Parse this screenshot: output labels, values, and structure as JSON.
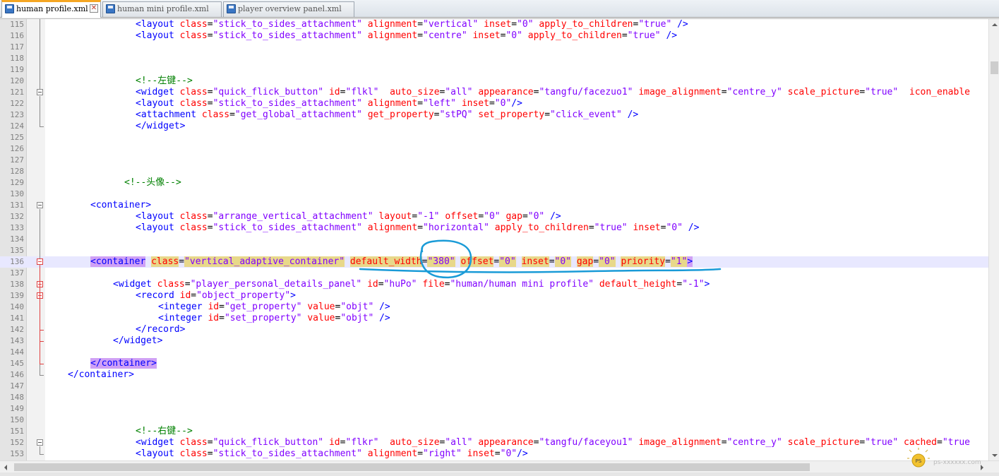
{
  "tabs": [
    {
      "label": "human profile.xml",
      "active": true
    },
    {
      "label": "human mini profile.xml",
      "active": false
    },
    {
      "label": "player overview panel.xml",
      "active": false
    }
  ],
  "tab_close_glyph": "✕",
  "highlight_color": "#e8e8ff",
  "annotation_color": "#1a9bd7",
  "watermark": {
    "badge": "PS",
    "text": "ps-xxxxxx.com"
  },
  "lines": [
    {
      "n": "115",
      "indent": 16,
      "tokens": [
        [
          "tag",
          "<layout "
        ],
        [
          "attr",
          "class"
        ],
        [
          "txt",
          "="
        ],
        [
          "val",
          "\"stick_to_sides_attachment\""
        ],
        [
          "txt",
          " "
        ],
        [
          "attr",
          "alignment"
        ],
        [
          "txt",
          "="
        ],
        [
          "val",
          "\"vertical\""
        ],
        [
          "txt",
          " "
        ],
        [
          "attr",
          "inset"
        ],
        [
          "txt",
          "="
        ],
        [
          "val",
          "\"0\""
        ],
        [
          "txt",
          " "
        ],
        [
          "attr",
          "apply_to_children"
        ],
        [
          "txt",
          "="
        ],
        [
          "val",
          "\"true\""
        ],
        [
          "txt",
          " "
        ],
        [
          "tag",
          "/>"
        ]
      ]
    },
    {
      "n": "116",
      "indent": 16,
      "tokens": [
        [
          "tag",
          "<layout "
        ],
        [
          "attr",
          "class"
        ],
        [
          "txt",
          "="
        ],
        [
          "val",
          "\"stick_to_sides_attachment\""
        ],
        [
          "txt",
          " "
        ],
        [
          "attr",
          "alignment"
        ],
        [
          "txt",
          "="
        ],
        [
          "val",
          "\"centre\""
        ],
        [
          "txt",
          " "
        ],
        [
          "attr",
          "inset"
        ],
        [
          "txt",
          "="
        ],
        [
          "val",
          "\"0\""
        ],
        [
          "txt",
          " "
        ],
        [
          "attr",
          "apply_to_children"
        ],
        [
          "txt",
          "="
        ],
        [
          "val",
          "\"true\""
        ],
        [
          "txt",
          " "
        ],
        [
          "tag",
          "/>"
        ]
      ]
    },
    {
      "n": "117",
      "indent": 0,
      "tokens": []
    },
    {
      "n": "118",
      "indent": 0,
      "tokens": []
    },
    {
      "n": "119",
      "indent": 0,
      "tokens": []
    },
    {
      "n": "120",
      "indent": 16,
      "tokens": [
        [
          "com",
          "<!--左键-->"
        ]
      ]
    },
    {
      "n": "121",
      "indent": 16,
      "tokens": [
        [
          "tag",
          "<widget "
        ],
        [
          "attr",
          "class"
        ],
        [
          "txt",
          "="
        ],
        [
          "val",
          "\"quick_flick_button\""
        ],
        [
          "txt",
          " "
        ],
        [
          "attr",
          "id"
        ],
        [
          "txt",
          "="
        ],
        [
          "val",
          "\"flkl\""
        ],
        [
          "txt",
          "  "
        ],
        [
          "attr",
          "auto_size"
        ],
        [
          "txt",
          "="
        ],
        [
          "val",
          "\"all\""
        ],
        [
          "txt",
          " "
        ],
        [
          "attr",
          "appearance"
        ],
        [
          "txt",
          "="
        ],
        [
          "val",
          "\"tangfu/facezuo1\""
        ],
        [
          "txt",
          " "
        ],
        [
          "attr",
          "image_alignment"
        ],
        [
          "txt",
          "="
        ],
        [
          "val",
          "\"centre_y\""
        ],
        [
          "txt",
          " "
        ],
        [
          "attr",
          "scale_picture"
        ],
        [
          "txt",
          "="
        ],
        [
          "val",
          "\"true\""
        ],
        [
          "txt",
          "  "
        ],
        [
          "attr",
          "icon_enable"
        ]
      ]
    },
    {
      "n": "122",
      "indent": 16,
      "tokens": [
        [
          "tag",
          "<layout "
        ],
        [
          "attr",
          "class"
        ],
        [
          "txt",
          "="
        ],
        [
          "val",
          "\"stick_to_sides_attachment\""
        ],
        [
          "txt",
          " "
        ],
        [
          "attr",
          "alignment"
        ],
        [
          "txt",
          "="
        ],
        [
          "val",
          "\"left\""
        ],
        [
          "txt",
          " "
        ],
        [
          "attr",
          "inset"
        ],
        [
          "txt",
          "="
        ],
        [
          "val",
          "\"0\""
        ],
        [
          "tag",
          "/>"
        ]
      ]
    },
    {
      "n": "123",
      "indent": 16,
      "tokens": [
        [
          "tag",
          "<attachment "
        ],
        [
          "attr",
          "class"
        ],
        [
          "txt",
          "="
        ],
        [
          "val",
          "\"get_global_attachment\""
        ],
        [
          "txt",
          " "
        ],
        [
          "attr",
          "get_property"
        ],
        [
          "txt",
          "="
        ],
        [
          "val",
          "\"stPQ\""
        ],
        [
          "txt",
          " "
        ],
        [
          "attr",
          "set_property"
        ],
        [
          "txt",
          "="
        ],
        [
          "val",
          "\"click_event\""
        ],
        [
          "txt",
          " "
        ],
        [
          "tag",
          "/>"
        ]
      ]
    },
    {
      "n": "124",
      "indent": 16,
      "tokens": [
        [
          "tag",
          "</widget>"
        ]
      ]
    },
    {
      "n": "125",
      "indent": 0,
      "tokens": []
    },
    {
      "n": "126",
      "indent": 0,
      "tokens": []
    },
    {
      "n": "127",
      "indent": 0,
      "tokens": []
    },
    {
      "n": "128",
      "indent": 0,
      "tokens": []
    },
    {
      "n": "129",
      "indent": 14,
      "tokens": [
        [
          "com",
          "<!--头像-->"
        ]
      ]
    },
    {
      "n": "130",
      "indent": 0,
      "tokens": []
    },
    {
      "n": "131",
      "indent": 8,
      "tokens": [
        [
          "tag",
          "<container>"
        ]
      ]
    },
    {
      "n": "132",
      "indent": 16,
      "tokens": [
        [
          "tag",
          "<layout "
        ],
        [
          "attr",
          "class"
        ],
        [
          "txt",
          "="
        ],
        [
          "val",
          "\"arrange_vertical_attachment\""
        ],
        [
          "txt",
          " "
        ],
        [
          "attr",
          "layout"
        ],
        [
          "txt",
          "="
        ],
        [
          "val",
          "\"-1\""
        ],
        [
          "txt",
          " "
        ],
        [
          "attr",
          "offset"
        ],
        [
          "txt",
          "="
        ],
        [
          "val",
          "\"0\""
        ],
        [
          "txt",
          " "
        ],
        [
          "attr",
          "gap"
        ],
        [
          "txt",
          "="
        ],
        [
          "val",
          "\"0\""
        ],
        [
          "txt",
          " "
        ],
        [
          "tag",
          "/>"
        ]
      ]
    },
    {
      "n": "133",
      "indent": 16,
      "tokens": [
        [
          "tag",
          "<layout "
        ],
        [
          "attr",
          "class"
        ],
        [
          "txt",
          "="
        ],
        [
          "val",
          "\"stick_to_sides_attachment\""
        ],
        [
          "txt",
          " "
        ],
        [
          "attr",
          "alignment"
        ],
        [
          "txt",
          "="
        ],
        [
          "val",
          "\"horizontal\""
        ],
        [
          "txt",
          " "
        ],
        [
          "attr",
          "apply_to_children"
        ],
        [
          "txt",
          "="
        ],
        [
          "val",
          "\"true\""
        ],
        [
          "txt",
          " "
        ],
        [
          "attr",
          "inset"
        ],
        [
          "txt",
          "="
        ],
        [
          "val",
          "\"0\""
        ],
        [
          "txt",
          " "
        ],
        [
          "tag",
          "/>"
        ]
      ]
    },
    {
      "n": "134",
      "indent": 0,
      "tokens": []
    },
    {
      "n": "135",
      "indent": 0,
      "tokens": []
    },
    {
      "n": "136",
      "indent": 8,
      "tokens": [
        [
          "tag",
          "<container"
        ],
        [
          "txt",
          " "
        ],
        [
          "attr",
          "class"
        ],
        [
          "txt",
          "="
        ],
        [
          "val",
          "\"vertical_adaptive_container\""
        ],
        [
          "txt",
          " "
        ],
        [
          "attr",
          "default_width"
        ],
        [
          "txt",
          "="
        ],
        [
          "val",
          "\"380\""
        ],
        [
          "txt",
          " "
        ],
        [
          "attr",
          "offset"
        ],
        [
          "txt",
          "="
        ],
        [
          "val",
          "\"0\""
        ],
        [
          "txt",
          " "
        ],
        [
          "attr",
          "inset"
        ],
        [
          "txt",
          "="
        ],
        [
          "val",
          "\"0\""
        ],
        [
          "txt",
          " "
        ],
        [
          "attr",
          "gap"
        ],
        [
          "txt",
          "="
        ],
        [
          "val",
          "\"0\""
        ],
        [
          "txt",
          " "
        ],
        [
          "attr",
          "priority"
        ],
        [
          "txt",
          "="
        ],
        [
          "val",
          "\"1\""
        ],
        [
          "tag",
          ">"
        ]
      ]
    },
    {
      "n": "137",
      "indent": 0,
      "tokens": []
    },
    {
      "n": "138",
      "indent": 12,
      "tokens": [
        [
          "tag",
          "<widget "
        ],
        [
          "attr",
          "class"
        ],
        [
          "txt",
          "="
        ],
        [
          "val",
          "\"player_personal_details_panel\""
        ],
        [
          "txt",
          " "
        ],
        [
          "attr",
          "id"
        ],
        [
          "txt",
          "="
        ],
        [
          "val",
          "\"huPo\""
        ],
        [
          "txt",
          " "
        ],
        [
          "attr",
          "file"
        ],
        [
          "txt",
          "="
        ],
        [
          "val",
          "\"human/human mini profile\""
        ],
        [
          "txt",
          " "
        ],
        [
          "attr",
          "default_height"
        ],
        [
          "txt",
          "="
        ],
        [
          "val",
          "\"-1\""
        ],
        [
          "tag",
          ">"
        ]
      ]
    },
    {
      "n": "139",
      "indent": 16,
      "tokens": [
        [
          "tag",
          "<record "
        ],
        [
          "attr",
          "id"
        ],
        [
          "txt",
          "="
        ],
        [
          "val",
          "\"object_property\""
        ],
        [
          "tag",
          ">"
        ]
      ]
    },
    {
      "n": "140",
      "indent": 20,
      "tokens": [
        [
          "tag",
          "<integer "
        ],
        [
          "attr",
          "id"
        ],
        [
          "txt",
          "="
        ],
        [
          "val",
          "\"get_property\""
        ],
        [
          "txt",
          " "
        ],
        [
          "attr",
          "value"
        ],
        [
          "txt",
          "="
        ],
        [
          "val",
          "\"objt\""
        ],
        [
          "txt",
          " "
        ],
        [
          "tag",
          "/>"
        ]
      ]
    },
    {
      "n": "141",
      "indent": 20,
      "tokens": [
        [
          "tag",
          "<integer "
        ],
        [
          "attr",
          "id"
        ],
        [
          "txt",
          "="
        ],
        [
          "val",
          "\"set_property\""
        ],
        [
          "txt",
          " "
        ],
        [
          "attr",
          "value"
        ],
        [
          "txt",
          "="
        ],
        [
          "val",
          "\"objt\""
        ],
        [
          "txt",
          " "
        ],
        [
          "tag",
          "/>"
        ]
      ]
    },
    {
      "n": "142",
      "indent": 16,
      "tokens": [
        [
          "tag",
          "</record>"
        ]
      ]
    },
    {
      "n": "143",
      "indent": 12,
      "tokens": [
        [
          "tag",
          "</widget>"
        ]
      ]
    },
    {
      "n": "144",
      "indent": 0,
      "tokens": []
    },
    {
      "n": "145",
      "indent": 8,
      "tokens": [
        [
          "tag",
          "</container>"
        ]
      ]
    },
    {
      "n": "146",
      "indent": 4,
      "tokens": [
        [
          "tag",
          "</container>"
        ]
      ]
    },
    {
      "n": "147",
      "indent": 0,
      "tokens": []
    },
    {
      "n": "148",
      "indent": 0,
      "tokens": []
    },
    {
      "n": "149",
      "indent": 0,
      "tokens": []
    },
    {
      "n": "150",
      "indent": 0,
      "tokens": []
    },
    {
      "n": "151",
      "indent": 16,
      "tokens": [
        [
          "com",
          "<!--右键-->"
        ]
      ]
    },
    {
      "n": "152",
      "indent": 16,
      "tokens": [
        [
          "tag",
          "<widget "
        ],
        [
          "attr",
          "class"
        ],
        [
          "txt",
          "="
        ],
        [
          "val",
          "\"quick_flick_button\""
        ],
        [
          "txt",
          " "
        ],
        [
          "attr",
          "id"
        ],
        [
          "txt",
          "="
        ],
        [
          "val",
          "\"flkr\""
        ],
        [
          "txt",
          "  "
        ],
        [
          "attr",
          "auto_size"
        ],
        [
          "txt",
          "="
        ],
        [
          "val",
          "\"all\""
        ],
        [
          "txt",
          " "
        ],
        [
          "attr",
          "appearance"
        ],
        [
          "txt",
          "="
        ],
        [
          "val",
          "\"tangfu/faceyou1\""
        ],
        [
          "txt",
          " "
        ],
        [
          "attr",
          "image_alignment"
        ],
        [
          "txt",
          "="
        ],
        [
          "val",
          "\"centre_y\""
        ],
        [
          "txt",
          " "
        ],
        [
          "attr",
          "scale_picture"
        ],
        [
          "txt",
          "="
        ],
        [
          "val",
          "\"true\""
        ],
        [
          "txt",
          " "
        ],
        [
          "attr",
          "cached"
        ],
        [
          "txt",
          "="
        ],
        [
          "val",
          "\"true"
        ]
      ]
    },
    {
      "n": "153",
      "indent": 16,
      "tokens": [
        [
          "tag",
          "<layout "
        ],
        [
          "attr",
          "class"
        ],
        [
          "txt",
          "="
        ],
        [
          "val",
          "\"stick_to_sides_attachment\""
        ],
        [
          "txt",
          " "
        ],
        [
          "attr",
          "alignment"
        ],
        [
          "txt",
          "="
        ],
        [
          "val",
          "\"right\""
        ],
        [
          "txt",
          " "
        ],
        [
          "attr",
          "inset"
        ],
        [
          "txt",
          "="
        ],
        [
          "val",
          "\"0\""
        ],
        [
          "tag",
          "/>"
        ]
      ]
    }
  ]
}
